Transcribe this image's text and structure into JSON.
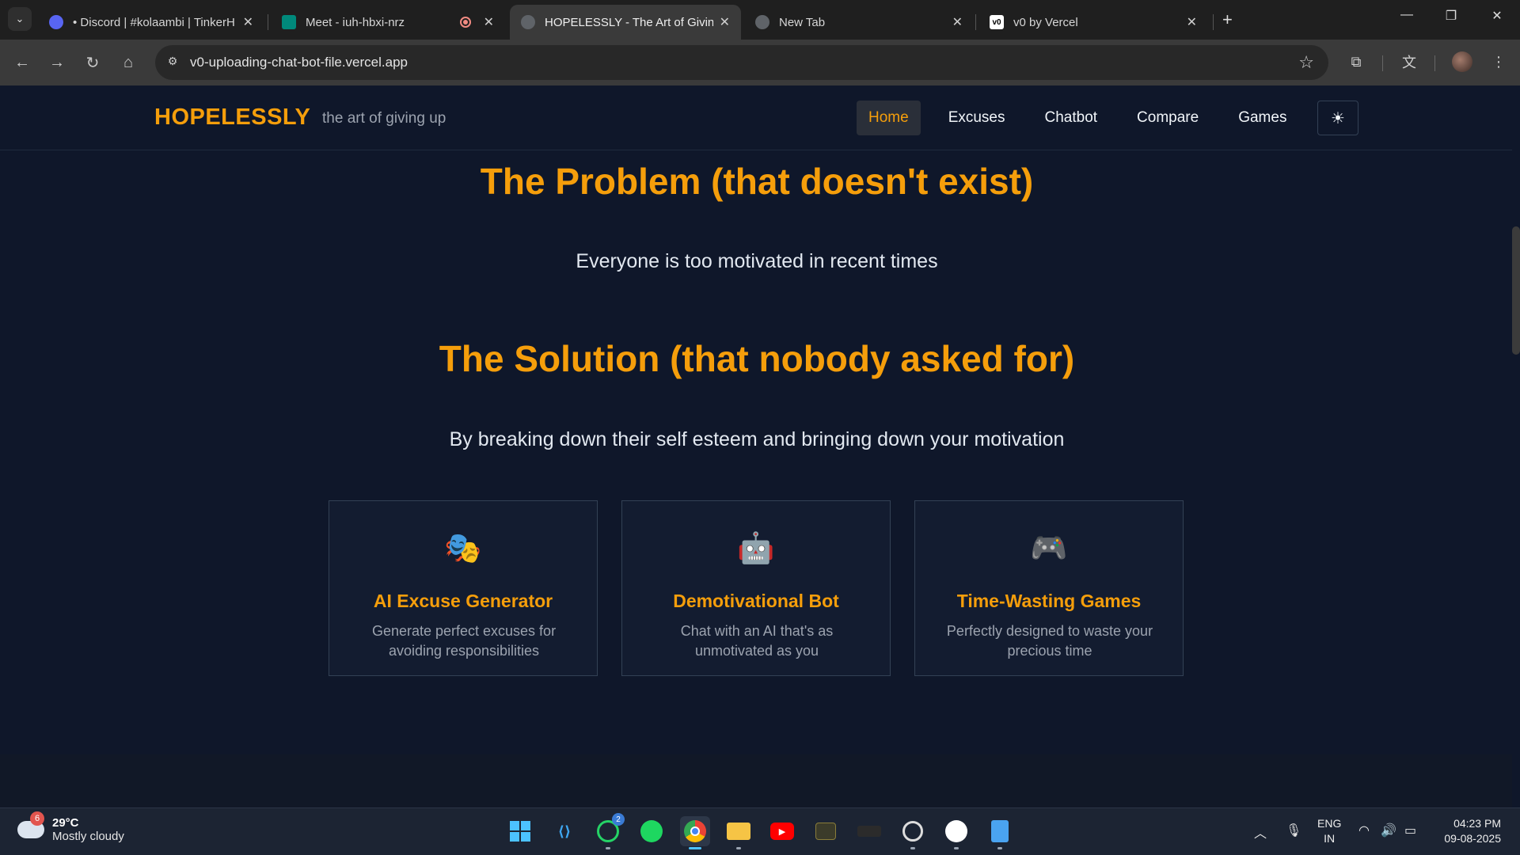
{
  "browser": {
    "tabs": [
      {
        "title": "• Discord | #kolaambi | TinkerH",
        "fav_color": "#5865f2"
      },
      {
        "title": "Meet - iuh-hbxi-nrz",
        "fav_color": "#00897b"
      },
      {
        "title": "HOPELESSLY - The Art of Giving",
        "fav_color": "#9aa0a6"
      },
      {
        "title": "New Tab",
        "fav_color": "#9aa0a6"
      },
      {
        "title": "v0 by Vercel",
        "fav_color": "#ffffff",
        "fav_text": "v0"
      }
    ],
    "url": "v0-uploading-chat-bot-file.vercel.app"
  },
  "site": {
    "brand": "HOPELESSLY",
    "tagline": "the art of giving up",
    "nav": [
      "Home",
      "Excuses",
      "Chatbot",
      "Compare",
      "Games"
    ],
    "active_nav": "Home",
    "accent": "#f59e0b",
    "background": "#0f172a"
  },
  "content": {
    "problem_title": "The Problem (that doesn't exist)",
    "problem_text": "Everyone is too motivated in recent times",
    "solution_title": "The Solution (that nobody asked for)",
    "solution_text": "By breaking down their self esteem and bringing down your motivation",
    "cards": [
      {
        "emoji": "🎭",
        "title": "AI Excuse Generator",
        "desc": "Generate perfect excuses for avoiding responsibilities"
      },
      {
        "emoji": "🤖",
        "title": "Demotivational Bot",
        "desc": "Chat with an AI that's as unmotivated as you"
      },
      {
        "emoji": "🎮",
        "title": "Time-Wasting Games",
        "desc": "Perfectly designed to waste your precious time"
      }
    ]
  },
  "taskbar": {
    "weather_badge": "6",
    "temperature": "29°C",
    "condition": "Mostly cloudy",
    "whatsapp_badge": "2",
    "lang_top": "ENG",
    "lang_bottom": "IN",
    "time": "04:23 PM",
    "date": "09-08-2025"
  }
}
